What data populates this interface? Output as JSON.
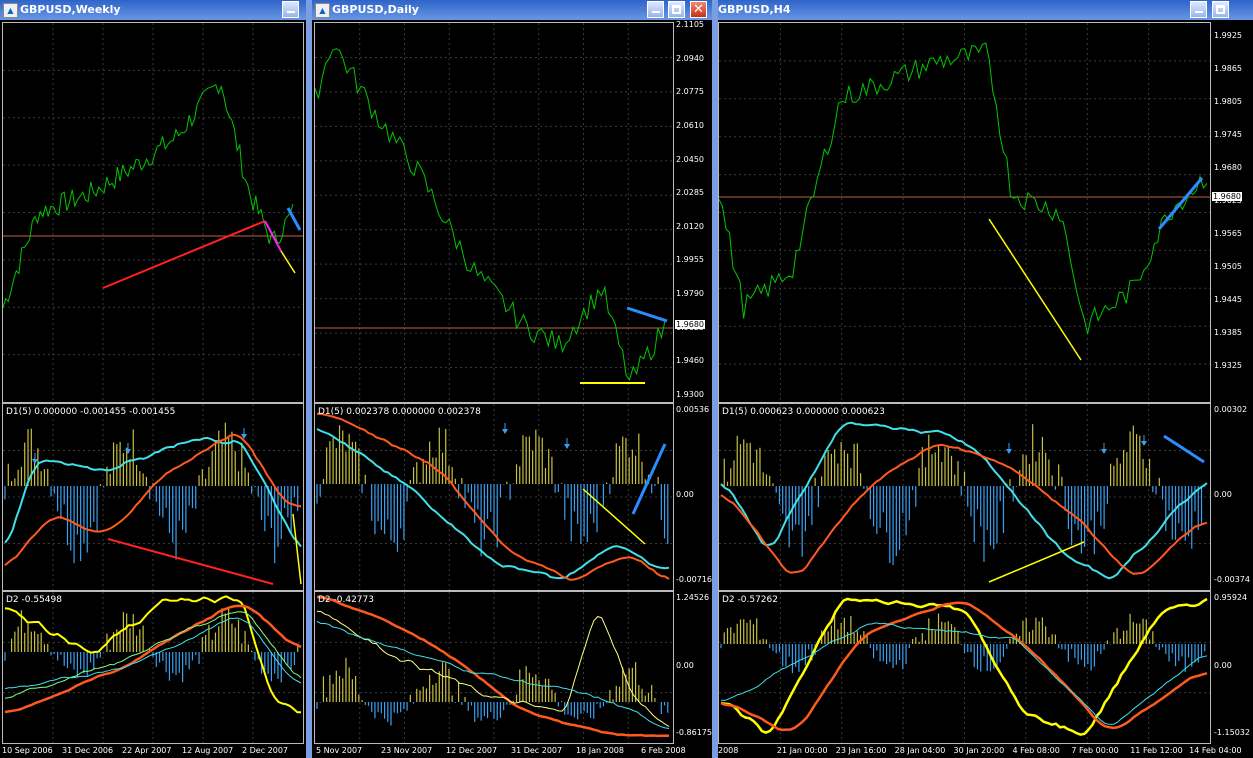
{
  "windows": [
    {
      "title": "GBPUSD,Weekly",
      "main_prices": [],
      "ind1_label": "D1(5) 0.000000 -0.001455 -0.001455",
      "ind1_scale": [],
      "ind2_label": "D2 -0.55498",
      "ind2_scale": [],
      "dates": [
        "10 Sep 2006",
        "31 Dec 2006",
        "22 Apr 2007",
        "12 Aug 2007",
        "2 Dec 2007"
      ]
    },
    {
      "title": "GBPUSD,Daily",
      "main_prices": [
        "2.1105",
        "2.0940",
        "2.0775",
        "2.0610",
        "2.0450",
        "2.0285",
        "2.0120",
        "1.9955",
        "1.9790",
        "1.9625",
        "1.9460",
        "1.9300"
      ],
      "current_price": "1.9680",
      "ind1_label": "D1(5) 0.002378 0.000000 0.002378",
      "ind1_scale": [
        "0.00536",
        "0.00",
        "-0.00716"
      ],
      "ind2_label": "D2 -0.42773",
      "ind2_scale": [
        "1.24526",
        "0.00",
        "-0.86175"
      ],
      "dates": [
        "5 Nov 2007",
        "23 Nov 2007",
        "12 Dec 2007",
        "31 Dec 2007",
        "18 Jan 2008",
        "6 Feb 2008"
      ]
    },
    {
      "title": "GBPUSD,H4",
      "main_prices": [
        "1.9925",
        "1.9865",
        "1.9805",
        "1.9745",
        "1.9680",
        "1.9625",
        "1.9565",
        "1.9505",
        "1.9445",
        "1.9385",
        "1.9325"
      ],
      "current_price": "1.9680",
      "ind1_label": "D1(5) 0.000623 0.000000 0.000623",
      "ind1_scale": [
        "0.00302",
        "0.00",
        "-0.00374"
      ],
      "ind2_label": "D2 -0.57262",
      "ind2_scale": [
        "0.95924",
        "0.00",
        "-1.15032"
      ],
      "dates": [
        "2008",
        "21 Jan 00:00",
        "23 Jan 16:00",
        "28 Jan 04:00",
        "30 Jan 20:00",
        "4 Feb 08:00",
        "7 Feb 00:00",
        "11 Feb 12:00",
        "14 Feb 04:00"
      ]
    }
  ],
  "colors": {
    "price_line": "#00c800",
    "cyan": "#40e0e8",
    "orange": "#ff5a1e",
    "yellow": "#ffff00",
    "steel_blue": "#3aa0f0",
    "olive_bar": "#c8c040",
    "hline": "#c06040"
  }
}
